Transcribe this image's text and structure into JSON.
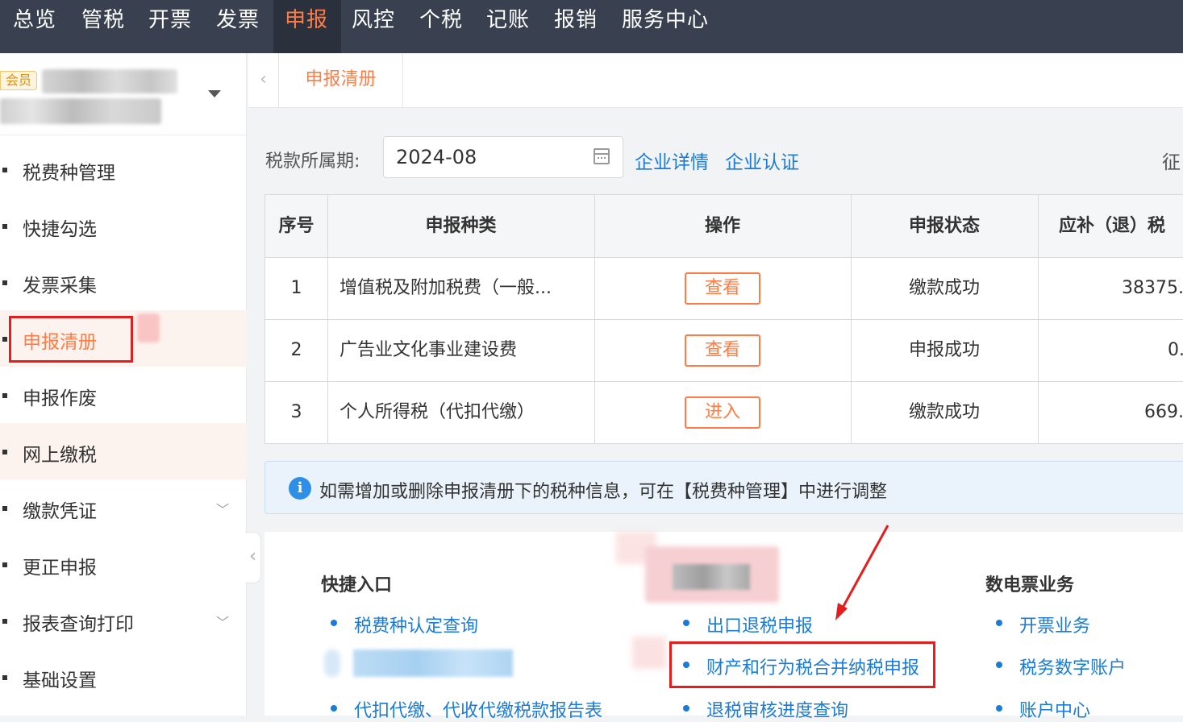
{
  "topnav": {
    "items": [
      {
        "label": "总览"
      },
      {
        "label": "管税"
      },
      {
        "label": "开票"
      },
      {
        "label": "发票"
      },
      {
        "label": "申报",
        "active": true
      },
      {
        "label": "风控"
      },
      {
        "label": "个税"
      },
      {
        "label": "记账"
      },
      {
        "label": "报销"
      },
      {
        "label": "服务中心"
      }
    ]
  },
  "member": {
    "badge": "会员"
  },
  "sidebar": {
    "items": [
      {
        "label": "税费种管理"
      },
      {
        "label": "快捷勾选"
      },
      {
        "label": "发票采集"
      },
      {
        "label": "申报清册",
        "active": true
      },
      {
        "label": "申报作废"
      },
      {
        "label": "网上缴税"
      },
      {
        "label": "缴款凭证",
        "expandable": true
      },
      {
        "label": "更正申报"
      },
      {
        "label": "报表查询打印",
        "expandable": true
      },
      {
        "label": "基础设置"
      }
    ]
  },
  "tabs": {
    "active_label": "申报清册"
  },
  "filter": {
    "period_label": "税款所属期:",
    "period_value": "2024-08",
    "link_company_detail": "企业详情",
    "link_company_cert": "企业认证",
    "cut_text": "征"
  },
  "table": {
    "headers": [
      "序号",
      "申报种类",
      "操作",
      "申报状态",
      "应补（退）税"
    ],
    "rows": [
      {
        "index": "1",
        "type": "增值税及附加税费（一般...",
        "action": "查看",
        "status": "缴款成功",
        "amount": "38375."
      },
      {
        "index": "2",
        "type": "广告业文化事业建设费",
        "action": "查看",
        "status": "申报成功",
        "amount": "0."
      },
      {
        "index": "3",
        "type": "个人所得税（代扣代缴）",
        "action": "进入",
        "status": "缴款成功",
        "amount": "669."
      }
    ]
  },
  "notice": {
    "text": "如需增加或删除申报清册下的税种信息，可在【税费种管理】中进行调整"
  },
  "quick": {
    "col1_title": "快捷入口",
    "col1_links": [
      "税费种认定查询",
      "代扣代缴、代收代缴税款报告表"
    ],
    "col2_links": [
      "出口退税申报",
      "财产和行为税合并纳税申报",
      "退税审核进度查询"
    ],
    "col3_title": "数电票业务",
    "col3_links": [
      "开票业务",
      "税务数字账户",
      "账户中心"
    ]
  },
  "colors": {
    "accent": "#ff7d45",
    "nav_bg": "#394150",
    "link": "#1b7bd6",
    "highlight_box": "#e41e1e"
  }
}
